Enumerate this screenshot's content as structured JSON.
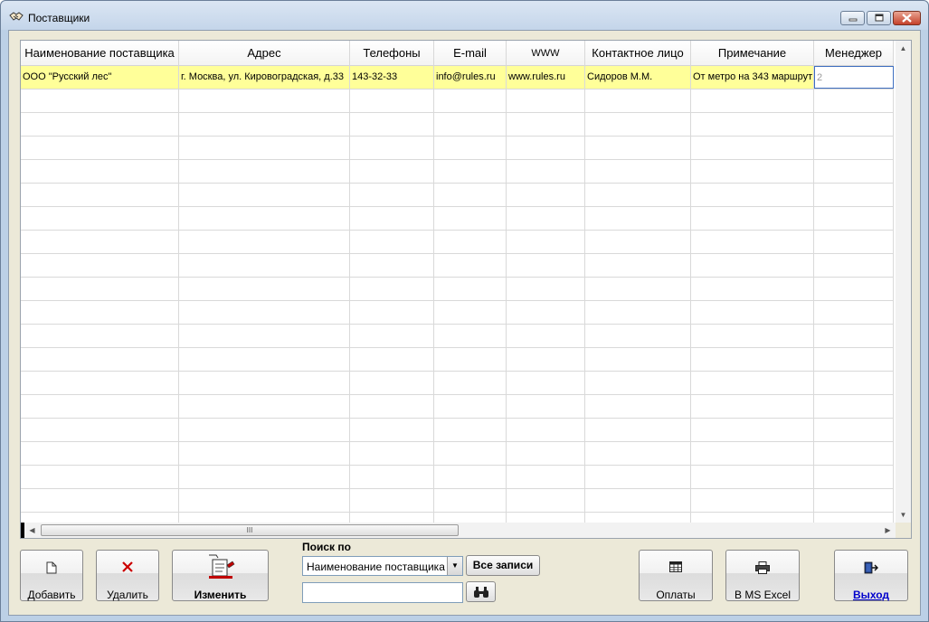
{
  "window": {
    "title": "Поставщики"
  },
  "columns": [
    "Наименование поставщика",
    "Адрес",
    "Телефоны",
    "E-mail",
    "WWW",
    "Контактное лицо",
    "Примечание",
    "Менеджер"
  ],
  "rows": [
    [
      "ООО \"Русский лес\"",
      "г. Москва, ул. Кировоградская, д.33",
      "143-32-33",
      "info@rules.ru",
      "www.rules.ru",
      "Сидоров М.М.",
      "От метро на 343 маршрут",
      "2"
    ]
  ],
  "empty_row_count": 19,
  "scrollbar": {
    "thumb_grip": "III"
  },
  "buttons": {
    "add": "Добавить",
    "delete": "Удалить",
    "edit": "Изменить",
    "payments": "Оплаты",
    "excel": "В MS Excel",
    "exit": "Выход"
  },
  "search": {
    "label": "Поиск по",
    "field_value": "Наименование поставщика",
    "all_records": "Все записи",
    "query": ""
  },
  "colors": {
    "selected_row": "#ffff99",
    "delete_icon": "#cc0000",
    "exit_link": "#0000cc"
  }
}
